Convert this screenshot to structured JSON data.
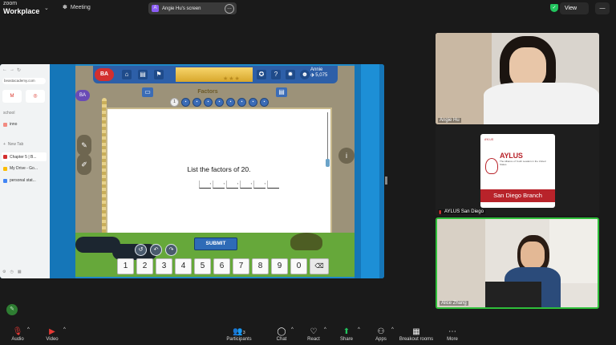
{
  "app": {
    "brand_top": "zoom",
    "brand_bottom": "Workplace"
  },
  "topbar": {
    "meeting_label": "Meeting",
    "screen_pill_initial": "A",
    "screen_pill_label": "Angie Hu's screen",
    "view_label": "View"
  },
  "browser": {
    "url": "beastacademy.com",
    "groups": [
      "school",
      "inno"
    ],
    "new_tab_label": "New Tab",
    "tabs": [
      "Chapter 5 | B...",
      "My Drive - Go...",
      "personal stat..."
    ]
  },
  "game": {
    "logo": "BA",
    "user_name": "Annie",
    "user_points": "5,075",
    "title": "Factors",
    "current_step": "1",
    "prompt": "List the factors of 20.",
    "submit_label": "SUBMIT",
    "keypad": [
      "1",
      "2",
      "3",
      "4",
      "5",
      "6",
      "7",
      "8",
      "9",
      "0"
    ]
  },
  "participants": [
    {
      "name": "Angie Hu"
    },
    {
      "name": "AYLUS San Diego",
      "card_title": "AYLUS",
      "card_subtitle": "The Alliance of Youth Leaders in the United States",
      "card_branch": "San Diego Branch"
    },
    {
      "name": "Alice Zhang"
    }
  ],
  "bottombar": {
    "audio": "Audio",
    "video": "Video",
    "participants": "Participants",
    "participants_count": "3",
    "chat": "Chat",
    "react": "React",
    "share": "Share",
    "apps": "Apps",
    "breakout": "Breakout rooms",
    "more": "More"
  },
  "colors": {
    "accent_green": "#22c55e",
    "mic_red": "#e53935",
    "aylus_red": "#b8232a",
    "game_blue": "#2d5fa8"
  }
}
